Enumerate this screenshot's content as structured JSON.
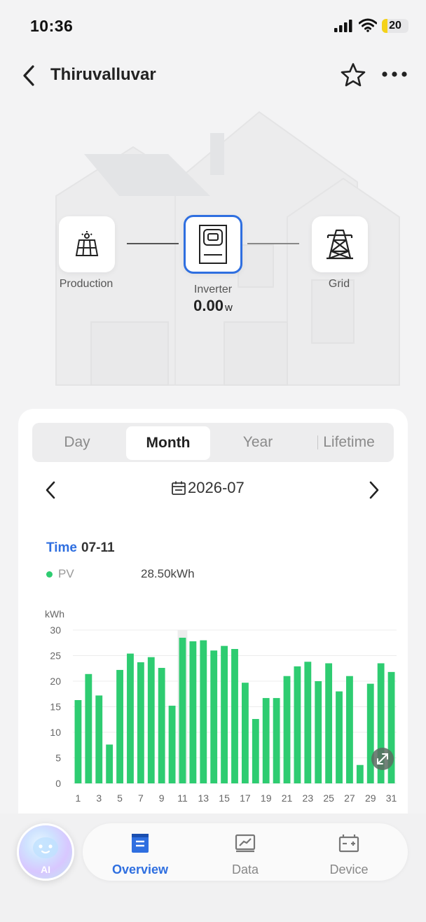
{
  "status_bar": {
    "time": "10:36",
    "battery": "20",
    "battery_level": 0.2
  },
  "nav": {
    "title": "Thiruvalluvar"
  },
  "flow": {
    "production_label": "Production",
    "inverter_label": "Inverter",
    "grid_label": "Grid",
    "inverter_value": "0.00",
    "inverter_unit": "w"
  },
  "tabs": {
    "items": [
      "Day",
      "Month",
      "Year",
      "Lifetime"
    ],
    "selected": "Month"
  },
  "date": {
    "value": "2026-07"
  },
  "tooltip": {
    "time_label": "Time",
    "time_value": "07-11",
    "series": "PV",
    "value": "28.50kWh"
  },
  "chart_data": {
    "type": "bar",
    "ylabel": "kWh",
    "ylim": [
      0,
      30
    ],
    "yticks": [
      30,
      25,
      20,
      15,
      10,
      5,
      0
    ],
    "categories": [
      "1",
      "2",
      "3",
      "4",
      "5",
      "6",
      "7",
      "8",
      "9",
      "10",
      "11",
      "12",
      "13",
      "14",
      "15",
      "16",
      "17",
      "18",
      "19",
      "20",
      "21",
      "22",
      "23",
      "24",
      "25",
      "26",
      "27",
      "28",
      "29",
      "30",
      "31"
    ],
    "xtick_labels": [
      "1",
      "3",
      "5",
      "7",
      "9",
      "11",
      "13",
      "15",
      "17",
      "19",
      "21",
      "23",
      "25",
      "27",
      "29",
      "31"
    ],
    "series": [
      {
        "name": "PV",
        "color": "#2ecc71",
        "values": [
          16.3,
          21.4,
          17.2,
          7.6,
          22.2,
          25.4,
          23.7,
          24.7,
          22.6,
          15.2,
          28.5,
          27.8,
          28.0,
          26.0,
          26.9,
          26.3,
          19.7,
          12.6,
          16.7,
          16.7,
          21.0,
          22.9,
          23.8,
          20.0,
          23.5,
          18.0,
          21.0,
          3.6,
          19.5,
          23.5,
          21.8
        ]
      }
    ],
    "highlight_category": "11",
    "grid": true
  },
  "bottom_nav": {
    "ai_label": "AI",
    "tabs": [
      "Overview",
      "Data",
      "Device"
    ],
    "active": "Overview"
  }
}
